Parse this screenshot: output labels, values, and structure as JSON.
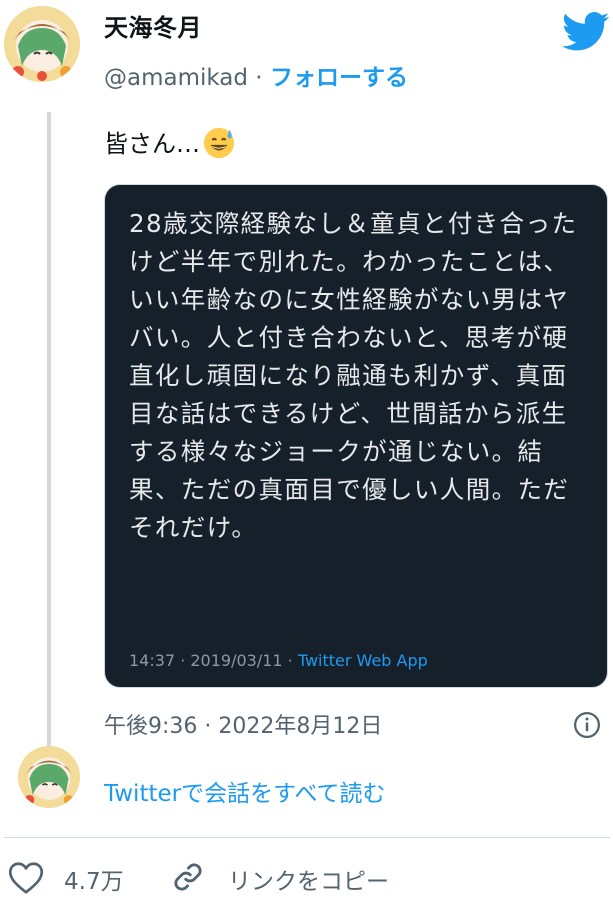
{
  "author": {
    "display_name": "天海冬月",
    "handle": "@amamikad",
    "separator": " · ",
    "follow_label": "フォローする"
  },
  "tweet": {
    "text": "皆さん…",
    "emoji": "grinning-face-with-sweat-icon"
  },
  "quoted_card": {
    "text": "28歳交際経験なし＆童貞と付き合ったけど半年で別れた。わかったことは、いい年齢なのに女性経験がない男はヤバい。人と付き合わないと、思考が硬直化し頑固になり融通も利かず、真面目な話はできるけど、世間話から派生する様々なジョークが通じない。結果、ただの真面目で優しい人間。ただそれだけ。",
    "meta_time": "14:37 · 2019/03/11 · ",
    "meta_app": "Twitter Web App",
    "background": "#15202b"
  },
  "timestamp": "午後9:36 · 2022年8月12日",
  "read_all_label": "Twitterで会話をすべて読む",
  "actions": {
    "like_count": "4.7万",
    "copy_link_label": "リンクをコピー"
  },
  "icons": {
    "brand": "twitter-logo-icon",
    "info": "info-icon",
    "like": "heart-icon",
    "link": "link-icon"
  },
  "colors": {
    "accent": "#1d9bf0",
    "secondary_text": "#536471",
    "thread_line": "#cfd9de"
  }
}
